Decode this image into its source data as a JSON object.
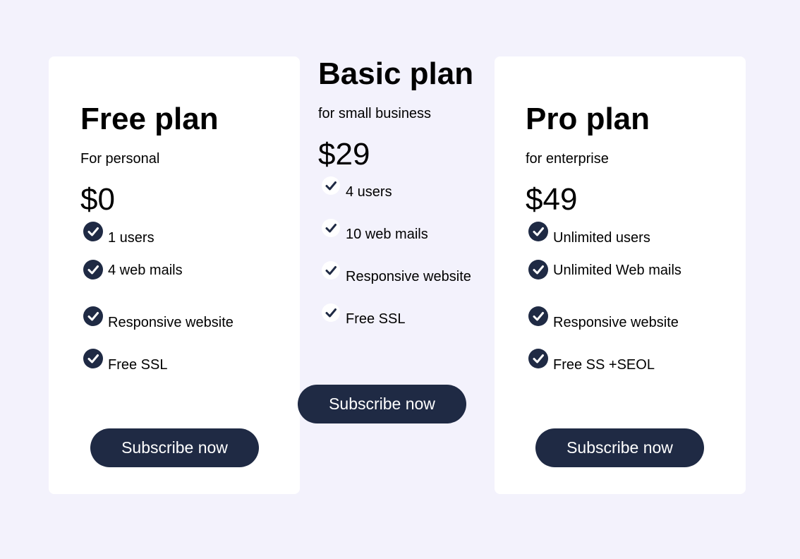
{
  "plans": [
    {
      "title": "Free plan",
      "subtitle": "For personal",
      "price": "$0",
      "features": [
        "1 users",
        "4 web mails",
        "Responsive website",
        "Free SSL"
      ],
      "button_label": "Subscribe now"
    },
    {
      "title": "Basic plan",
      "subtitle": "for small business",
      "price": "$29",
      "features": [
        "4 users",
        "10 web mails",
        "Responsive website",
        "Free SSL"
      ],
      "button_label": "Subscribe now"
    },
    {
      "title": "Pro plan",
      "subtitle": "for enterprise",
      "price": "$49",
      "features": [
        "Unlimited users",
        "Unlimited Web mails",
        "Responsive website",
        "Free SS +SEOL"
      ],
      "button_label": "Subscribe now"
    }
  ],
  "icons": {
    "feature_icon": "check-circle-icon"
  },
  "colors": {
    "background": "#f3f2fc",
    "card": "#ffffff",
    "accent": "#1f2a44"
  }
}
